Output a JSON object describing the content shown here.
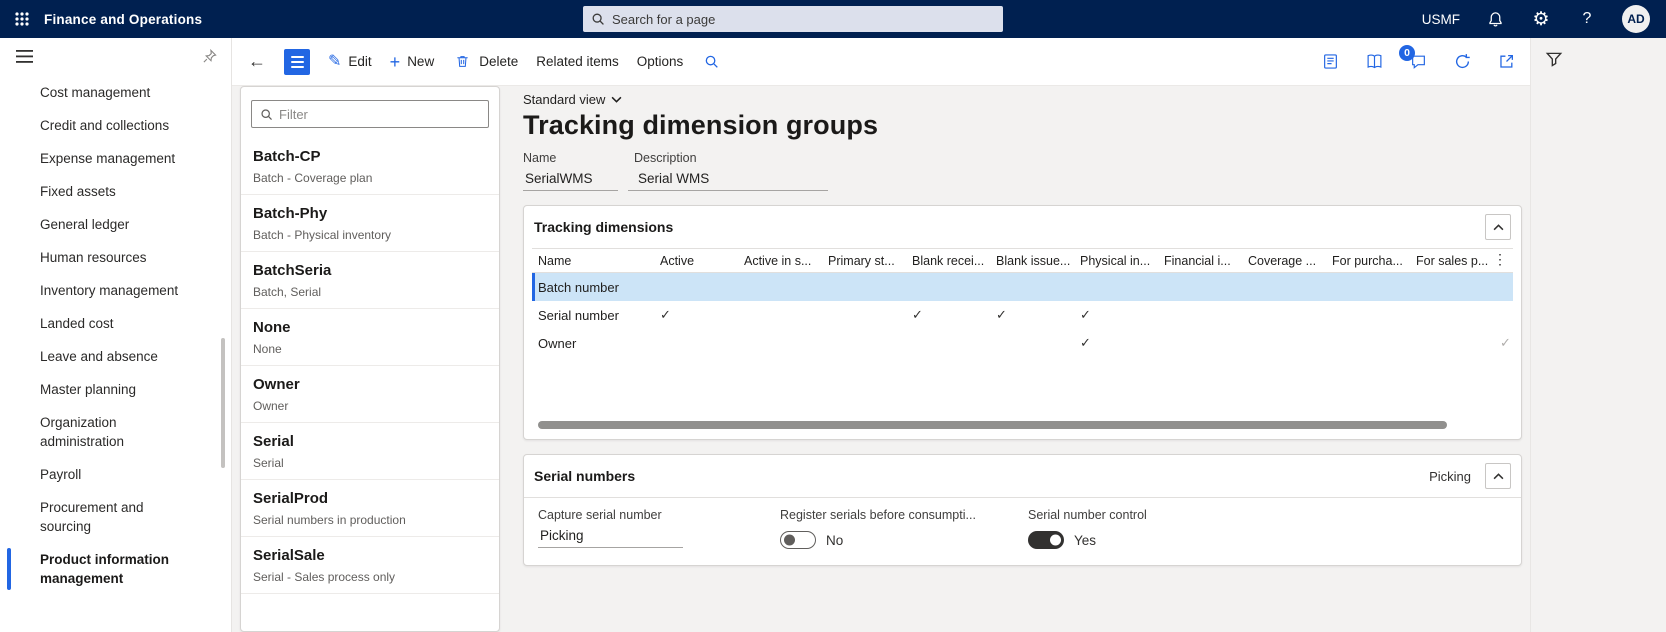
{
  "topbar": {
    "app_title": "Finance and Operations",
    "search_placeholder": "Search for a page",
    "company": "USMF",
    "avatar_initials": "AD"
  },
  "sidebar": {
    "items": [
      {
        "label": "Cost management",
        "selected": false
      },
      {
        "label": "Credit and collections",
        "selected": false
      },
      {
        "label": "Expense management",
        "selected": false
      },
      {
        "label": "Fixed assets",
        "selected": false
      },
      {
        "label": "General ledger",
        "selected": false
      },
      {
        "label": "Human resources",
        "selected": false
      },
      {
        "label": "Inventory management",
        "selected": false
      },
      {
        "label": "Landed cost",
        "selected": false
      },
      {
        "label": "Leave and absence",
        "selected": false
      },
      {
        "label": "Master planning",
        "selected": false
      },
      {
        "label": "Organization administration",
        "selected": false
      },
      {
        "label": "Payroll",
        "selected": false
      },
      {
        "label": "Procurement and sourcing",
        "selected": false
      },
      {
        "label": "Product information management",
        "selected": true
      }
    ]
  },
  "toolbar": {
    "edit_label": "Edit",
    "new_label": "New",
    "delete_label": "Delete",
    "related_items_label": "Related items",
    "options_label": "Options",
    "badge_count": "0"
  },
  "record_list": {
    "filter_placeholder": "Filter",
    "items": [
      {
        "name": "Batch-CP",
        "description": "Batch - Coverage plan"
      },
      {
        "name": "Batch-Phy",
        "description": "Batch - Physical inventory"
      },
      {
        "name": "BatchSeria",
        "description": "Batch, Serial"
      },
      {
        "name": "None",
        "description": "None"
      },
      {
        "name": "Owner",
        "description": "Owner"
      },
      {
        "name": "Serial",
        "description": "Serial"
      },
      {
        "name": "SerialProd",
        "description": "Serial numbers in production"
      },
      {
        "name": "SerialSale",
        "description": "Serial - Sales process only"
      }
    ]
  },
  "page": {
    "view_selector": "Standard view",
    "title": "Tracking dimension groups",
    "name_field": {
      "label": "Name",
      "value": "SerialWMS"
    },
    "description_field": {
      "label": "Description",
      "value": "Serial WMS"
    }
  },
  "tracking_dimensions": {
    "section_title": "Tracking dimensions",
    "columns": [
      "Name",
      "Active",
      "Active in s...",
      "Primary st...",
      "Blank recei...",
      "Blank issue...",
      "Physical in...",
      "Financial i...",
      "Coverage ...",
      "For purcha...",
      "For sales p..."
    ],
    "rows": [
      {
        "name": "Batch number",
        "selected": true,
        "checks": [
          0,
          0,
          0,
          0,
          0,
          0,
          0,
          0,
          0,
          0,
          0
        ]
      },
      {
        "name": "Serial number",
        "selected": false,
        "checks": [
          1,
          0,
          0,
          1,
          1,
          1,
          0,
          0,
          0,
          0,
          0
        ]
      },
      {
        "name": "Owner",
        "selected": false,
        "checks": [
          0,
          0,
          0,
          0,
          0,
          1,
          0,
          0,
          0,
          0,
          1
        ]
      }
    ]
  },
  "serial_numbers": {
    "section_title": "Serial numbers",
    "header_value": "Picking",
    "fields": [
      {
        "label": "Capture serial number",
        "type": "input",
        "value": "Picking"
      },
      {
        "label": "Register serials before consumpti...",
        "type": "toggle",
        "value": "No"
      },
      {
        "label": "Serial number control",
        "type": "toggle",
        "value": "Yes"
      }
    ]
  },
  "colors": {
    "topbar": "#002050",
    "accent": "#2266E3",
    "selected_row": "#cce4f7"
  }
}
